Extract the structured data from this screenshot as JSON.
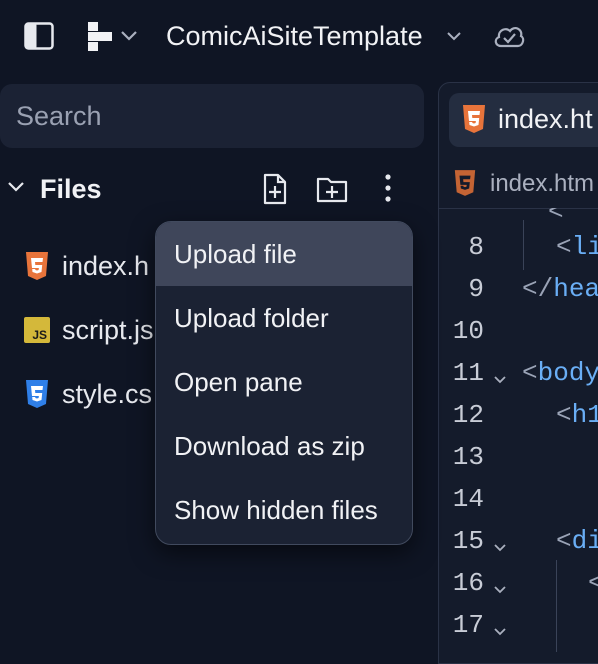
{
  "topbar": {
    "project_name": "ComicAiSiteTemplate",
    "icons": [
      "sidebar-toggle-icon",
      "project-graph-icon",
      "chevron-down-icon",
      "cloud-check-icon"
    ]
  },
  "search": {
    "placeholder": "Search"
  },
  "files_panel": {
    "title": "Files",
    "actions": [
      "new-file-icon",
      "new-folder-icon",
      "more-options-icon"
    ],
    "files": [
      {
        "name": "index.html",
        "visible_text": "index.h",
        "icon": "html5-icon",
        "color": "#e8743b"
      },
      {
        "name": "script.js",
        "visible_text": "script.js",
        "icon": "js-icon",
        "color": "#d4b83a"
      },
      {
        "name": "style.css",
        "visible_text": "style.cs",
        "icon": "css3-icon",
        "color": "#2f7fe8"
      }
    ]
  },
  "context_menu": {
    "items": [
      {
        "label": "Upload file",
        "active": true
      },
      {
        "label": "Upload folder"
      },
      {
        "label": "Open pane"
      },
      {
        "label": "Download as zip"
      },
      {
        "label": "Show hidden files"
      }
    ]
  },
  "editor": {
    "tab_label": "index.ht",
    "breadcrumb": "index.htm",
    "lines": [
      {
        "num": "8",
        "code_open": "<",
        "code_tag": "li",
        "fold": false
      },
      {
        "num": "9",
        "code_open": "</",
        "code_tag": "hea",
        "fold": false
      },
      {
        "num": "10",
        "code_open": "",
        "code_tag": "",
        "fold": false
      },
      {
        "num": "11",
        "code_open": "<",
        "code_tag": "body",
        "fold": true
      },
      {
        "num": "12",
        "code_open": "<",
        "code_tag": "h1",
        "fold": false
      },
      {
        "num": "13",
        "code_open": "",
        "code_tag": "",
        "fold": false
      },
      {
        "num": "14",
        "code_open": "",
        "code_tag": "",
        "fold": false
      },
      {
        "num": "15",
        "code_open": "<",
        "code_tag": "di",
        "fold": true
      },
      {
        "num": "16",
        "code_open": "<",
        "code_tag": "",
        "fold": true
      },
      {
        "num": "17",
        "code_open": "",
        "code_tag": "",
        "fold": true
      }
    ]
  },
  "colors": {
    "background": "#0f1524",
    "panel": "#1b2234",
    "menu_active": "#3f465a",
    "html_orange": "#e8743b",
    "tag_blue": "#6aaef5"
  }
}
